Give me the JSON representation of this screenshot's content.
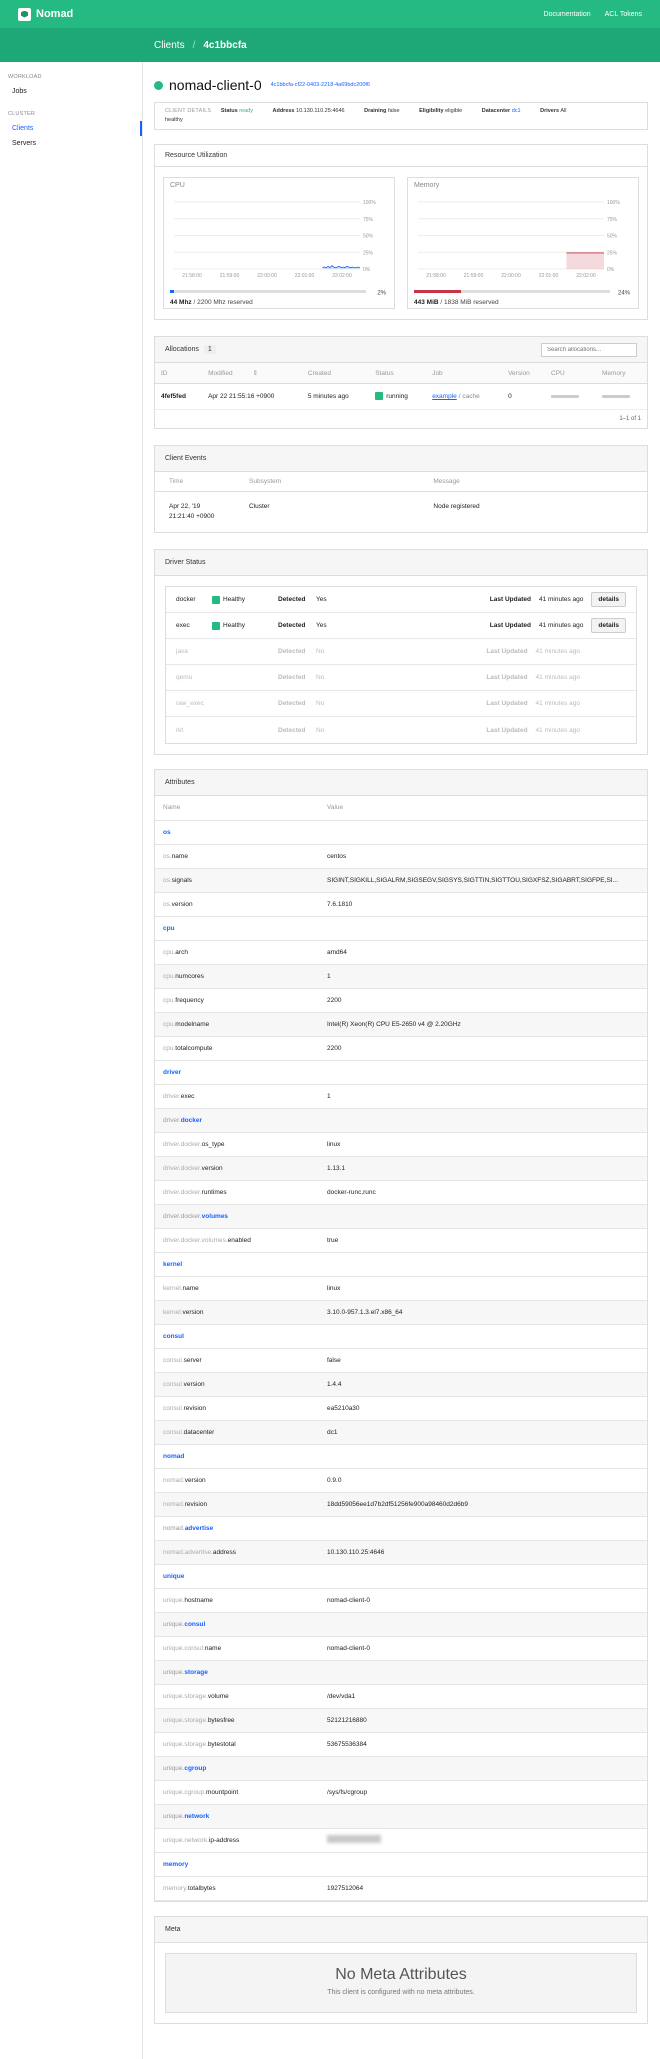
{
  "topbar": {
    "brand": "Nomad",
    "nav": [
      "Documentation",
      "ACL Tokens"
    ]
  },
  "breadcrumb": {
    "root": "Clients",
    "sep": "/",
    "current": "4c1bbcfa"
  },
  "sidebar": {
    "groups": [
      {
        "label": "WORKLOAD",
        "items": [
          "Jobs"
        ]
      },
      {
        "label": "CLUSTER",
        "items": [
          "Clients",
          "Servers"
        ]
      }
    ],
    "active": "Clients"
  },
  "client": {
    "name": "nomad-client-0",
    "id": "4c1bbcfa-cf22-0403-2218-4a69bdc200f6",
    "details_label": "CLIENT DETAILS",
    "status_label": "Status",
    "status": "ready",
    "address_label": "Address",
    "address": "10.130.110.25:4646",
    "draining_label": "Draining",
    "draining": "false",
    "eligibility_label": "Eligibility",
    "eligibility": "eligible",
    "datacenter_label": "Datacenter",
    "datacenter": "dc1",
    "drivers_label": "Drivers",
    "drivers": "All",
    "drivers_status": "healthy"
  },
  "utilization": {
    "title": "Resource Utilization",
    "colors": {
      "cpu": "#1563ff",
      "memory": "#c73445"
    },
    "cpu": {
      "label": "CPU",
      "used": "44 Mhz",
      "total": "/ 2200 Mhz reserved",
      "pct": "2%",
      "fraction": 0.02,
      "y_ticks": [
        "100%",
        "75%",
        "50%",
        "25%",
        "0%"
      ],
      "x_ticks": [
        "21:58:00",
        "21:59:00",
        "22:00:00",
        "22:01:00",
        "22:02:00"
      ],
      "series": [
        0,
        0,
        0,
        0,
        0,
        0,
        0,
        0,
        0,
        0,
        0,
        0,
        0,
        0,
        0,
        0,
        0,
        0,
        0,
        0,
        0,
        0,
        0,
        0,
        0,
        0,
        0,
        0,
        0,
        0,
        0,
        0,
        0,
        0,
        0,
        0,
        0,
        0,
        0,
        0,
        0,
        0,
        0,
        0,
        0,
        0,
        0,
        0,
        0,
        0,
        0,
        0,
        0,
        0,
        0,
        0,
        0,
        0,
        0,
        0,
        0,
        0,
        0,
        0,
        0,
        0,
        0,
        0,
        0,
        0,
        0,
        0,
        0,
        0,
        0,
        0,
        0,
        0,
        0,
        2,
        3,
        2,
        4,
        2,
        5,
        3,
        2,
        3,
        4,
        2,
        3,
        2,
        4,
        3,
        2,
        3,
        2,
        2,
        3,
        2
      ]
    },
    "memory": {
      "label": "Memory",
      "used": "443 MiB",
      "total": "/ 1838 MiB reserved",
      "pct": "24%",
      "fraction": 0.24,
      "y_ticks": [
        "100%",
        "75%",
        "50%",
        "25%",
        "0%"
      ],
      "x_ticks": [
        "21:58:00",
        "21:59:00",
        "22:00:00",
        "22:01:00",
        "22:02:00"
      ],
      "series": [
        0,
        0,
        0,
        0,
        0,
        0,
        0,
        0,
        0,
        0,
        0,
        0,
        0,
        0,
        0,
        0,
        0,
        0,
        0,
        0,
        0,
        0,
        0,
        0,
        0,
        0,
        0,
        0,
        0,
        0,
        0,
        0,
        0,
        0,
        0,
        0,
        0,
        0,
        0,
        0,
        0,
        0,
        0,
        0,
        0,
        0,
        0,
        0,
        0,
        0,
        0,
        0,
        0,
        0,
        0,
        0,
        0,
        0,
        0,
        0,
        0,
        0,
        0,
        0,
        0,
        0,
        0,
        0,
        0,
        0,
        0,
        0,
        0,
        0,
        0,
        0,
        0,
        0,
        0,
        24,
        24,
        24,
        24,
        24,
        24,
        24,
        24,
        24,
        24,
        24,
        24,
        24,
        24,
        24,
        24,
        24,
        24,
        24,
        24,
        24
      ]
    }
  },
  "allocations": {
    "title": "Allocations",
    "count": "1",
    "search_placeholder": "Search allocations...",
    "columns": [
      "ID",
      "Modified",
      "Created",
      "Status",
      "Job",
      "Version",
      "CPU",
      "Memory"
    ],
    "sort_icon": "⇕",
    "rows": [
      {
        "id": "4fef5fed",
        "modified": "Apr 22 21:55:16 +0900",
        "created": "5 minutes ago",
        "status": "running",
        "job": "example",
        "job_sub": "/ cache",
        "version": "0"
      }
    ],
    "pager": "1–1 of 1"
  },
  "events": {
    "title": "Client Events",
    "columns": [
      "Time",
      "Subsystem",
      "Message"
    ],
    "rows": [
      {
        "time": "Apr 22, '19 21:21:40 +0900",
        "subsystem": "Cluster",
        "message": "Node registered"
      }
    ]
  },
  "driver_status": {
    "title": "Driver Status",
    "detected_label": "Detected",
    "updated_label": "Last Updated",
    "details_label": "details",
    "rows": [
      {
        "name": "docker",
        "health": "Healthy",
        "detected": "Yes",
        "updated": "41 minutes ago",
        "active": true
      },
      {
        "name": "exec",
        "health": "Healthy",
        "detected": "Yes",
        "updated": "41 minutes ago",
        "active": true
      },
      {
        "name": "java",
        "health": "",
        "detected": "No",
        "updated": "41 minutes ago",
        "active": false
      },
      {
        "name": "qemu",
        "health": "",
        "detected": "No",
        "updated": "41 minutes ago",
        "active": false
      },
      {
        "name": "raw_exec",
        "health": "",
        "detected": "No",
        "updated": "41 minutes ago",
        "active": false
      },
      {
        "name": "rkt",
        "health": "",
        "detected": "No",
        "updated": "41 minutes ago",
        "active": false
      }
    ]
  },
  "attributes": {
    "title": "Attributes",
    "columns": [
      "Name",
      "Value"
    ],
    "rows": [
      {
        "t": "sec",
        "k": "os"
      },
      {
        "t": "r",
        "p": "os.",
        "k": "name",
        "v": "centos"
      },
      {
        "t": "r",
        "p": "os.",
        "k": "signals",
        "v": "SIGINT,SIGKILL,SIGALRM,SIGSEGV,SIGSYS,SIGTTIN,SIGTTOU,SIGXFSZ,SIGABRT,SIGFPE,SI..."
      },
      {
        "t": "r",
        "p": "os.",
        "k": "version",
        "v": "7.6.1810"
      },
      {
        "t": "sec",
        "k": "cpu"
      },
      {
        "t": "r",
        "p": "cpu.",
        "k": "arch",
        "v": "amd64"
      },
      {
        "t": "r",
        "p": "cpu.",
        "k": "numcores",
        "v": "1"
      },
      {
        "t": "r",
        "p": "cpu.",
        "k": "frequency",
        "v": "2200"
      },
      {
        "t": "r",
        "p": "cpu.",
        "k": "modelname",
        "v": "Intel(R) Xeon(R) CPU E5-2650 v4 @ 2.20GHz"
      },
      {
        "t": "r",
        "p": "cpu.",
        "k": "totalcompute",
        "v": "2200"
      },
      {
        "t": "sec",
        "k": "driver"
      },
      {
        "t": "r",
        "p": "driver.",
        "k": "exec",
        "v": "1"
      },
      {
        "t": "sub",
        "p": "driver.",
        "k": "docker"
      },
      {
        "t": "r",
        "p": "driver.docker.",
        "k": "os_type",
        "v": "linux"
      },
      {
        "t": "r",
        "p": "driver.docker.",
        "k": "version",
        "v": "1.13.1"
      },
      {
        "t": "r",
        "p": "driver.docker.",
        "k": "runtimes",
        "v": "docker-runc,runc"
      },
      {
        "t": "sub",
        "p": "driver.docker.",
        "k": "volumes"
      },
      {
        "t": "r",
        "p": "driver.docker.volumes.",
        "k": "enabled",
        "v": "true"
      },
      {
        "t": "sec",
        "k": "kernel"
      },
      {
        "t": "r",
        "p": "kernel.",
        "k": "name",
        "v": "linux"
      },
      {
        "t": "r",
        "p": "kernel.",
        "k": "version",
        "v": "3.10.0-957.1.3.el7.x86_64"
      },
      {
        "t": "sec",
        "k": "consul"
      },
      {
        "t": "r",
        "p": "consul.",
        "k": "server",
        "v": "false"
      },
      {
        "t": "r",
        "p": "consul.",
        "k": "version",
        "v": "1.4.4"
      },
      {
        "t": "r",
        "p": "consul.",
        "k": "revision",
        "v": "ea5210a30"
      },
      {
        "t": "r",
        "p": "consul.",
        "k": "datacenter",
        "v": "dc1"
      },
      {
        "t": "sec",
        "k": "nomad"
      },
      {
        "t": "r",
        "p": "nomad.",
        "k": "version",
        "v": "0.9.0"
      },
      {
        "t": "r",
        "p": "nomad.",
        "k": "revision",
        "v": "18dd59056ee1d7b2df51256fe900a98460d2d6b9"
      },
      {
        "t": "sub",
        "p": "nomad.",
        "k": "advertise"
      },
      {
        "t": "r",
        "p": "nomad.advertise.",
        "k": "address",
        "v": "10.130.110.25:4646"
      },
      {
        "t": "sec",
        "k": "unique"
      },
      {
        "t": "r",
        "p": "unique.",
        "k": "hostname",
        "v": "nomad-client-0"
      },
      {
        "t": "sub",
        "p": "unique.",
        "k": "consul"
      },
      {
        "t": "r",
        "p": "unique.consul.",
        "k": "name",
        "v": "nomad-client-0"
      },
      {
        "t": "sub",
        "p": "unique.",
        "k": "storage"
      },
      {
        "t": "r",
        "p": "unique.storage.",
        "k": "volume",
        "v": "/dev/vda1"
      },
      {
        "t": "r",
        "p": "unique.storage.",
        "k": "bytesfree",
        "v": "52121216880"
      },
      {
        "t": "r",
        "p": "unique.storage.",
        "k": "bytestotal",
        "v": "53675536384"
      },
      {
        "t": "sub",
        "p": "unique.",
        "k": "cgroup"
      },
      {
        "t": "r",
        "p": "unique.cgroup.",
        "k": "mountpoint",
        "v": "/sys/fs/cgroup"
      },
      {
        "t": "sub",
        "p": "unique.",
        "k": "network"
      },
      {
        "t": "r",
        "p": "unique.network.",
        "k": "ip-address",
        "v": "",
        "blur": true
      },
      {
        "t": "sec",
        "k": "memory"
      },
      {
        "t": "r",
        "p": "memory.",
        "k": "totalbytes",
        "v": "1927512064"
      }
    ]
  },
  "meta": {
    "title": "Meta",
    "empty_title": "No Meta Attributes",
    "empty_text": "This client is configured with no meta attributes."
  }
}
